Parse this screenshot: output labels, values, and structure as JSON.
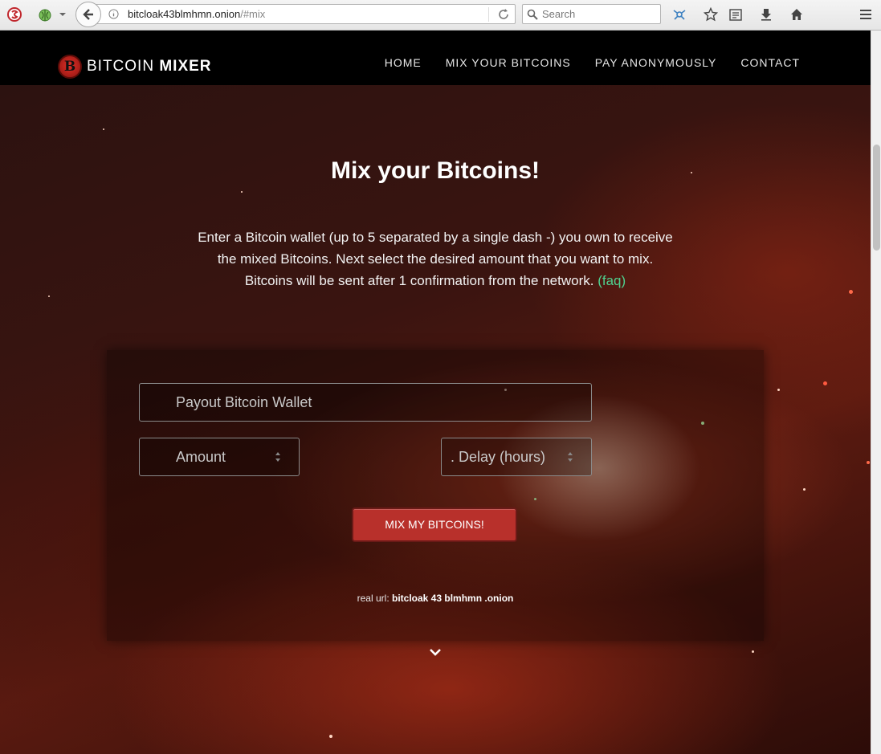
{
  "browser": {
    "url_host": "bitcloak43blmhmn.onion",
    "url_path": "/#mix",
    "search_placeholder": "Search"
  },
  "nav": {
    "brand_part1": "BITCOIN",
    "brand_part2": "MIXER",
    "logo_glyph": "B",
    "links": [
      "HOME",
      "MIX YOUR BITCOINS",
      "PAY ANONYMOUSLY",
      "CONTACT"
    ]
  },
  "hero": {
    "title": "Mix your Bitcoins!",
    "line1": "Enter a Bitcoin wallet (up to 5 separated by a single dash -) you own to receive",
    "line2": "the mixed Bitcoins. Next select the desired amount that you want to mix.",
    "line3": "Bitcoins will be sent after 1 confirmation from the network.",
    "faq": "(faq)"
  },
  "form": {
    "wallet_placeholder": "Payout Bitcoin Wallet",
    "amount_placeholder": "Amount",
    "delay_placeholder": ". Delay (hours)",
    "submit_label": "MIX MY BITCOINS!",
    "real_url_label": "real url:",
    "real_url_value": "bitcloak 43 blmhmn .onion"
  },
  "colors": {
    "accent_button": "#b8302b",
    "faq_link": "#4fd18f",
    "navbar": "#000000"
  },
  "icons": [
    "shield-icon",
    "addon-icon",
    "back-arrow-icon",
    "info-icon",
    "reload-icon",
    "search-icon",
    "network-icon",
    "bookmark-star-icon",
    "reading-list-icon",
    "download-icon",
    "home-icon",
    "menu-icon",
    "bitcoin-logo-icon",
    "spinner-icon",
    "chevron-down-icon"
  ]
}
